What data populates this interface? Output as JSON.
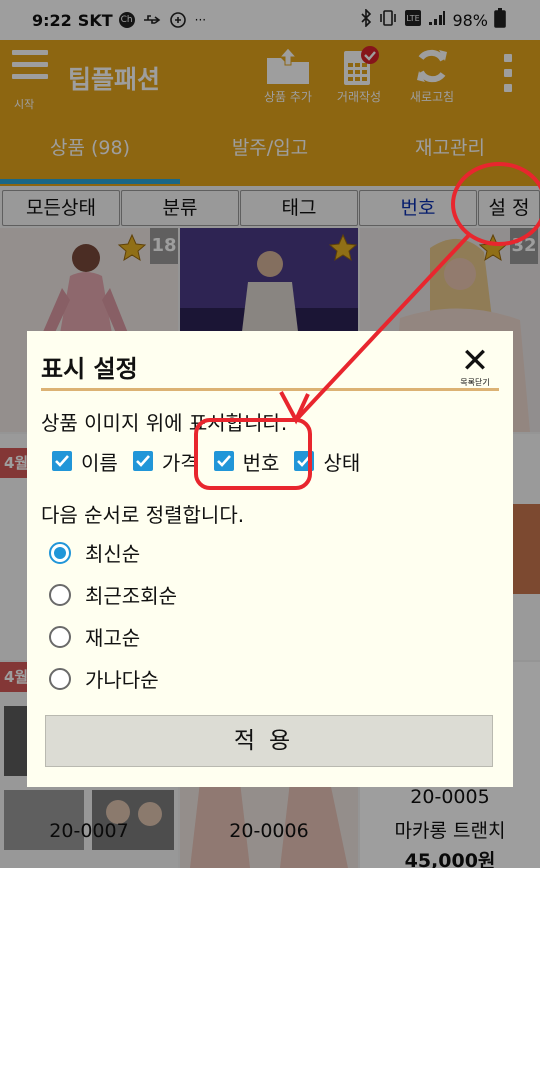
{
  "status_bar": {
    "time": "9:22",
    "carrier": "SKT",
    "carrier_badge": "Ch",
    "battery": "98%"
  },
  "app_bar": {
    "menu_label": "시작",
    "title": "팁플패션",
    "actions": [
      {
        "label": "상품 추가",
        "icon": "folder-upload-icon"
      },
      {
        "label": "거래작성",
        "icon": "calculator-check-icon"
      },
      {
        "label": "새로고침",
        "icon": "refresh-icon"
      }
    ]
  },
  "tabs": [
    {
      "label": "상품 (98)",
      "active": true
    },
    {
      "label": "발주/입고",
      "active": false
    },
    {
      "label": "재고관리",
      "active": false
    }
  ],
  "filters": [
    {
      "label": "모든상태"
    },
    {
      "label": "분류"
    },
    {
      "label": "태그"
    },
    {
      "label": "번호"
    },
    {
      "label": "설 정"
    }
  ],
  "grid": {
    "badges": [
      "18",
      "32"
    ],
    "ribbons": [
      "4월",
      "4월"
    ],
    "captions": [
      "20-0007",
      "20-0006",
      "20-0005"
    ],
    "product_name": "마카롱 트랜치",
    "product_price": "45,000원"
  },
  "dialog": {
    "title": "표시 설정",
    "close_label": "목록닫기",
    "display_section_label": "상품 이미지 위에 표시합니다.",
    "display_options": [
      {
        "label": "이름",
        "checked": true
      },
      {
        "label": "가격",
        "checked": true
      },
      {
        "label": "번호",
        "checked": true
      },
      {
        "label": "상태",
        "checked": true
      }
    ],
    "sort_section_label": "다음 순서로 정렬합니다.",
    "sort_options": [
      {
        "label": "최신순",
        "selected": true
      },
      {
        "label": "최근조회순",
        "selected": false
      },
      {
        "label": "재고순",
        "selected": false
      },
      {
        "label": "가나다순",
        "selected": false
      }
    ],
    "apply_label": "적용"
  },
  "colors": {
    "brand": "#e4a51c",
    "accent": "#2aa7d9",
    "annotation": "#e8262e",
    "dialog_bg": "#fffff0"
  }
}
